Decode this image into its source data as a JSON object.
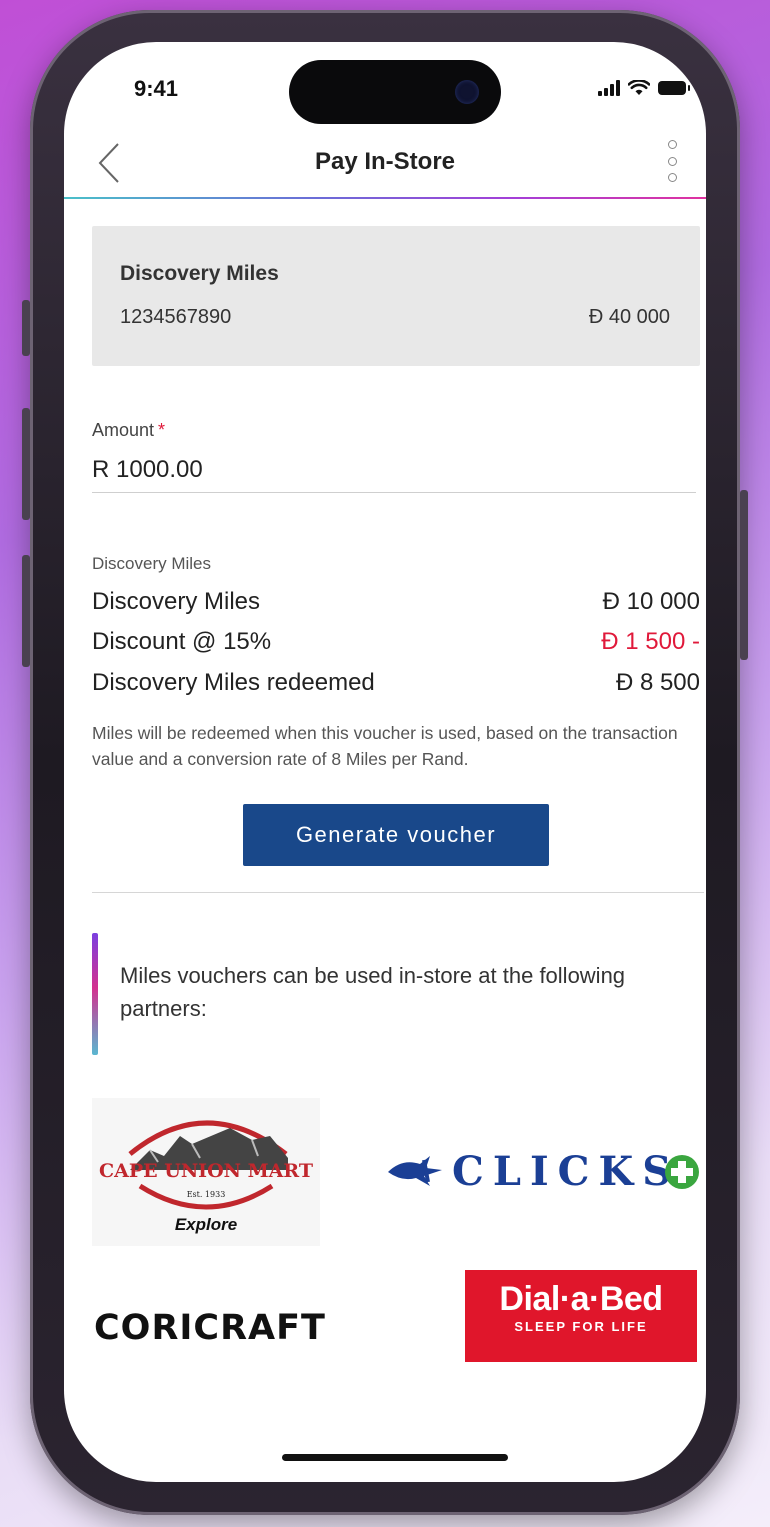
{
  "status_bar": {
    "time": "9:41"
  },
  "header": {
    "title": "Pay In-Store",
    "back_icon": "chevron-left-icon",
    "menu_icon": "more-vertical-icon"
  },
  "account": {
    "name": "Discovery Miles",
    "number": "1234567890",
    "balance": "Ð 40 000"
  },
  "amount": {
    "label": "Amount",
    "required_marker": "*",
    "value": "R 1000.00"
  },
  "summary": {
    "section_label": "Discovery Miles",
    "rows": [
      {
        "label": "Discovery Miles",
        "value": "Ð 10 000"
      },
      {
        "label": "Discount @ 15%",
        "value": "Ð 1 500 -"
      },
      {
        "label": "Discovery Miles redeemed",
        "value": "Ð 8 500"
      }
    ],
    "note": "Miles will be redeemed when this voucher is used, based on the transaction value and a conversion rate of 8 Miles per Rand."
  },
  "actions": {
    "generate_label": "Generate voucher"
  },
  "partners": {
    "intro": "Miles vouchers can be used in-store at the following partners:",
    "logos": [
      {
        "name": "CAPE UNION MART",
        "est": "Est. 1933",
        "tagline": "Explore"
      },
      {
        "name": "CLICKS"
      },
      {
        "name": "CORICRAFT"
      },
      {
        "name": "Dial·a·Bed",
        "tagline": "SLEEP FOR LIFE"
      }
    ]
  },
  "colors": {
    "primary_button": "#19488a",
    "negative": "#e0193a",
    "card_bg": "#e8e8e8",
    "clicks_blue": "#1b3f95",
    "clicks_green": "#3aa63f",
    "dialabed_red": "#e0162b",
    "cum_red": "#c0272d"
  }
}
